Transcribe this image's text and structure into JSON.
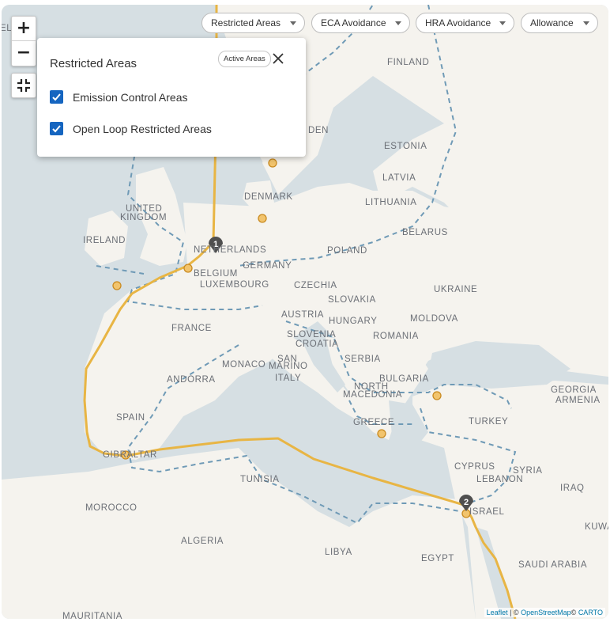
{
  "map": {
    "controls": {
      "zoom_in": "+",
      "zoom_out": "−",
      "fit_icon": "fullscreen-exit-icon"
    },
    "colors": {
      "land": "#f5f3ee",
      "sea": "#d6dfe3",
      "route": "#e8b544",
      "port_fill": "#f2c46d",
      "port_stroke": "#c98a20",
      "restricted_line": "#6f9ab6",
      "waypoint": "#4f4f4f",
      "checkbox": "#1565c0",
      "attribution_link": "#0078a8"
    },
    "filters": [
      {
        "label": "Restricted Areas"
      },
      {
        "label": "ECA Avoidance"
      },
      {
        "label": "HRA Avoidance"
      },
      {
        "label": "Allowance"
      }
    ],
    "panel": {
      "title": "Restricted Areas",
      "active_chip": "Active Areas",
      "options": [
        {
          "label": "Emission Control Areas",
          "checked": true
        },
        {
          "label": "Open Loop Restricted Areas",
          "checked": true
        }
      ]
    },
    "countries": [
      {
        "name": "FINLAND"
      },
      {
        "name": "ESTONIA"
      },
      {
        "name": "LATVIA"
      },
      {
        "name": "LITHUANIA"
      },
      {
        "name": "BELARUS"
      },
      {
        "name": "DENMARK"
      },
      {
        "name": "UNITED"
      },
      {
        "name": "KINGDOM"
      },
      {
        "name": "IRELAND"
      },
      {
        "name": "NETHERLANDS"
      },
      {
        "name": "BELGIUM"
      },
      {
        "name": "LUXEMBOURG"
      },
      {
        "name": "GERMANY"
      },
      {
        "name": "POLAND"
      },
      {
        "name": "CZECHIA"
      },
      {
        "name": "SLOVAKIA"
      },
      {
        "name": "UKRAINE"
      },
      {
        "name": "AUSTRIA"
      },
      {
        "name": "HUNGARY"
      },
      {
        "name": "MOLDOVA"
      },
      {
        "name": "FRANCE"
      },
      {
        "name": "SLOVENIA"
      },
      {
        "name": "CROATIA"
      },
      {
        "name": "ROMANIA"
      },
      {
        "name": "MONACO"
      },
      {
        "name": "SAN"
      },
      {
        "name": "MARINO"
      },
      {
        "name": "SERBIA"
      },
      {
        "name": "ANDORRA"
      },
      {
        "name": "ITALY"
      },
      {
        "name": "BULGARIA"
      },
      {
        "name": "NORTH"
      },
      {
        "name": "MACEDONIA"
      },
      {
        "name": "GEORGIA"
      },
      {
        "name": "ARMENIA"
      },
      {
        "name": "SPAIN"
      },
      {
        "name": "GREECE"
      },
      {
        "name": "TURKEY"
      },
      {
        "name": "GIBRALTAR"
      },
      {
        "name": "CYPRUS"
      },
      {
        "name": "SYRIA"
      },
      {
        "name": "LEBANON"
      },
      {
        "name": "TUNISIA"
      },
      {
        "name": "ISRAEL"
      },
      {
        "name": "IRAQ"
      },
      {
        "name": "MOROCCO"
      },
      {
        "name": "KUWA"
      },
      {
        "name": "ALGERIA"
      },
      {
        "name": "LIBYA"
      },
      {
        "name": "EGYPT"
      },
      {
        "name": "SAUDI ARABIA"
      },
      {
        "name": "MAURITANIA"
      },
      {
        "name": "EL"
      },
      {
        "name": "DEN"
      }
    ],
    "waypoints": [
      {
        "label": "1"
      },
      {
        "label": "2"
      }
    ],
    "attribution": {
      "leaflet": "Leaflet",
      "sep": " | © ",
      "osm": "OpenStreetMap",
      "carto_prefix": "© ",
      "carto": "CARTO"
    }
  }
}
